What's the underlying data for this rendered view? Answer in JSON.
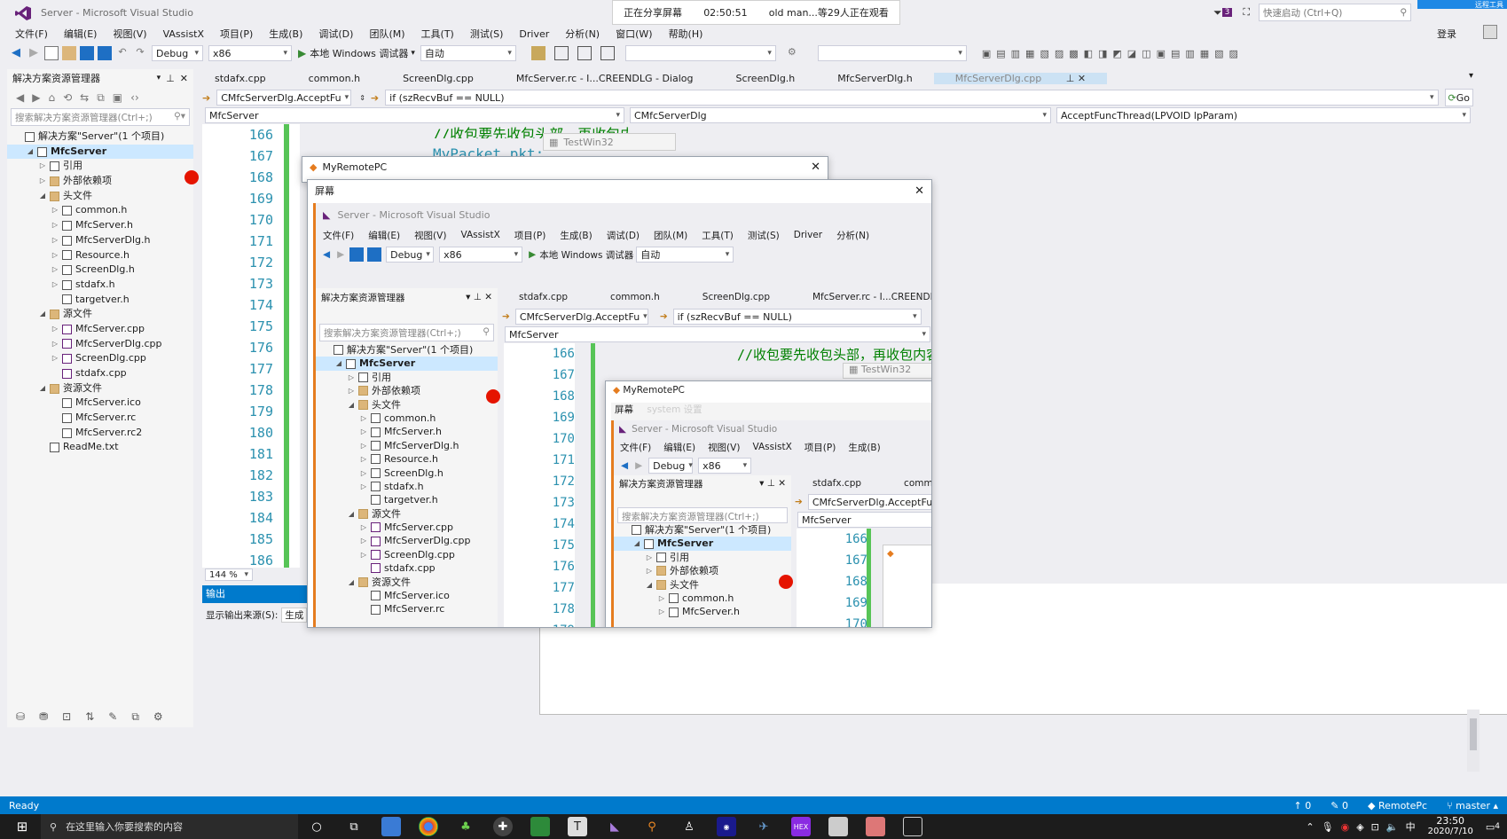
{
  "window": {
    "title": "Server - Microsoft Visual Studio"
  },
  "share_banner": {
    "status": "正在分享屏幕",
    "time": "02:50:51",
    "viewers": "old man...等29人正在观看"
  },
  "quick_launch": {
    "placeholder": "快速启动 (Ctrl+Q)",
    "notifications": "3",
    "login": "登录",
    "remote_label": "远程工具"
  },
  "menu": [
    "文件(F)",
    "编辑(E)",
    "视图(V)",
    "VAssistX",
    "项目(P)",
    "生成(B)",
    "调试(D)",
    "团队(M)",
    "工具(T)",
    "测试(S)",
    "Driver",
    "分析(N)",
    "窗口(W)",
    "帮助(H)"
  ],
  "toolbar": {
    "config": "Debug",
    "platform": "x86",
    "run_label": "本地 Windows 调试器",
    "run_mode": "自动"
  },
  "solution_explorer": {
    "title": "解决方案资源管理器",
    "search_placeholder": "搜索解决方案资源管理器(Ctrl+;)",
    "items": [
      {
        "label": "解决方案\"Server\"(1 个项目)",
        "indent": 0,
        "tw": "",
        "icon": "sln"
      },
      {
        "label": "MfcServer",
        "indent": 1,
        "tw": "◢",
        "icon": "proj",
        "bold": true,
        "selected": true
      },
      {
        "label": "引用",
        "indent": 2,
        "tw": "▷",
        "icon": "ref"
      },
      {
        "label": "外部依赖项",
        "indent": 2,
        "tw": "▷",
        "icon": "folder"
      },
      {
        "label": "头文件",
        "indent": 2,
        "tw": "◢",
        "icon": "folder"
      },
      {
        "label": "common.h",
        "indent": 3,
        "tw": "▷",
        "icon": "h"
      },
      {
        "label": "MfcServer.h",
        "indent": 3,
        "tw": "▷",
        "icon": "h"
      },
      {
        "label": "MfcServerDlg.h",
        "indent": 3,
        "tw": "▷",
        "icon": "h"
      },
      {
        "label": "Resource.h",
        "indent": 3,
        "tw": "▷",
        "icon": "h"
      },
      {
        "label": "ScreenDlg.h",
        "indent": 3,
        "tw": "▷",
        "icon": "h"
      },
      {
        "label": "stdafx.h",
        "indent": 3,
        "tw": "▷",
        "icon": "h"
      },
      {
        "label": "targetver.h",
        "indent": 3,
        "tw": "",
        "icon": "h"
      },
      {
        "label": "源文件",
        "indent": 2,
        "tw": "◢",
        "icon": "folder"
      },
      {
        "label": "MfcServer.cpp",
        "indent": 3,
        "tw": "▷",
        "icon": "cpp"
      },
      {
        "label": "MfcServerDlg.cpp",
        "indent": 3,
        "tw": "▷",
        "icon": "cpp"
      },
      {
        "label": "ScreenDlg.cpp",
        "indent": 3,
        "tw": "▷",
        "icon": "cpp"
      },
      {
        "label": "stdafx.cpp",
        "indent": 3,
        "tw": "",
        "icon": "cpp"
      },
      {
        "label": "资源文件",
        "indent": 2,
        "tw": "◢",
        "icon": "folder"
      },
      {
        "label": "MfcServer.ico",
        "indent": 3,
        "tw": "",
        "icon": "ico"
      },
      {
        "label": "MfcServer.rc",
        "indent": 3,
        "tw": "",
        "icon": "rc"
      },
      {
        "label": "MfcServer.rc2",
        "indent": 3,
        "tw": "",
        "icon": "rc"
      },
      {
        "label": "ReadMe.txt",
        "indent": 2,
        "tw": "",
        "icon": "txt"
      }
    ]
  },
  "tabs": [
    "stdafx.cpp",
    "common.h",
    "ScreenDlg.cpp",
    "MfcServer.rc - I...CREENDLG - Dialog",
    "ScreenDlg.h",
    "MfcServerDlg.h",
    "MfcServerDlg.cpp"
  ],
  "nav": {
    "scope": "CMfcServerDlg.AcceptFu",
    "condition": "if (szRecvBuf == NULL)",
    "project": "MfcServer",
    "class": "CMfcServerDlg",
    "function": "AcceptFuncThread(LPVOID lpParam)",
    "go": "Go"
  },
  "editor": {
    "line_numbers": [
      "166",
      "167",
      "168",
      "169",
      "170",
      "171",
      "172",
      "173",
      "174",
      "175",
      "176",
      "177",
      "178",
      "179",
      "180",
      "181",
      "182",
      "183",
      "184",
      "185",
      "186"
    ],
    "breakpoint_line": "168",
    "code_comment": "//收包要先收包头部，再收包内容",
    "code_line2": "MyPacket pkt;",
    "zoom": "144 %"
  },
  "output": {
    "title": "输出",
    "source_label": "显示输出来源(S):",
    "source_value": "生成"
  },
  "testwin": {
    "title": "TestWin32"
  },
  "remote_dialog": {
    "title": "MyRemotePC",
    "inner_title": "屏幕"
  },
  "inner_menu_extra": "system  设置",
  "status": {
    "ready": "Ready",
    "up": "0",
    "edit": "0",
    "repo": "RemotePc",
    "branch": "master"
  },
  "taskbar": {
    "search": "在这里输入你要搜索的内容",
    "time": "23:50",
    "date": "2020/7/10",
    "ime": "中",
    "notif": "4"
  }
}
